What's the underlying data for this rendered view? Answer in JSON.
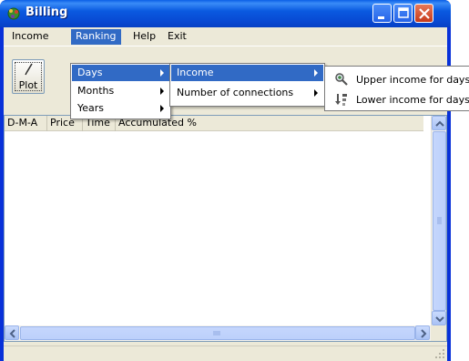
{
  "window": {
    "title": "Billing"
  },
  "menubar": {
    "items": [
      {
        "label": "Income",
        "underline": "I"
      },
      {
        "label": "Ranking",
        "underline": "R"
      },
      {
        "label": "Help",
        "underline": "H"
      },
      {
        "label": "Exit",
        "underline": "E"
      }
    ]
  },
  "toolbar": {
    "plot_label": "Plot"
  },
  "listview": {
    "columns": [
      "D-M-A",
      "Price",
      "Time",
      "Accumulated %"
    ]
  },
  "ranking_menu": {
    "items": [
      {
        "label": "Days"
      },
      {
        "label": "Months"
      },
      {
        "label": "Years"
      }
    ]
  },
  "days_submenu": {
    "items": [
      {
        "label": "Income"
      },
      {
        "label": "Number of connections"
      }
    ]
  },
  "income_submenu": {
    "items": [
      {
        "label": "Upper income for days",
        "icon": "magnifier-icon"
      },
      {
        "label": "Lower income for days",
        "icon": "sort-icon"
      }
    ]
  },
  "colors": {
    "accent": "#316ac5",
    "titlebar": "#0a5ae0",
    "chrome": "#ece9d8"
  }
}
